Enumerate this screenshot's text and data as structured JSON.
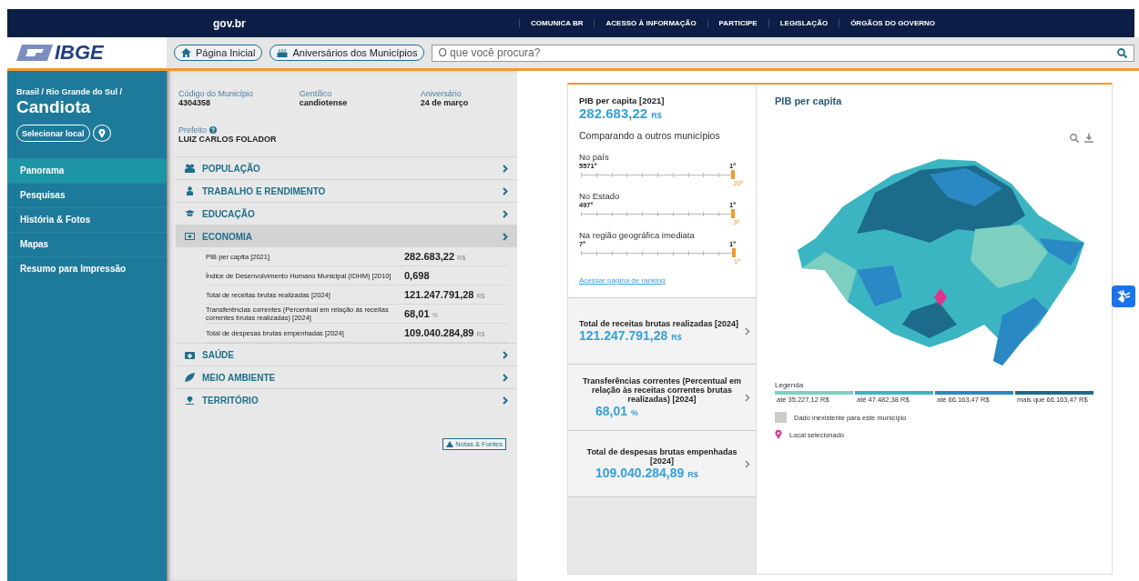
{
  "gov_bar": {
    "logo": "gov.br",
    "links": [
      "COMUNICA BR",
      "ACESSO À INFORMAÇÃO",
      "PARTICIPE",
      "LEGISLAÇÃO",
      "ÓRGÃOS DO GOVERNO"
    ]
  },
  "header": {
    "logo": "IBGE",
    "buttons": [
      {
        "label": "Página Inicial",
        "kind": "home"
      },
      {
        "label": "Aniversários dos Municípios",
        "kind": "cake"
      }
    ],
    "search": {
      "placeholder": "O que você procura?"
    }
  },
  "sidebar": {
    "breadcrumb": "Brasil / Rio Grande do Sul /",
    "place": "Candiota",
    "select_button": "Selecionar local",
    "items": [
      {
        "label": "Panorama",
        "selected": true
      },
      {
        "label": "Pesquisas",
        "selected": false
      },
      {
        "label": "História & Fotos",
        "selected": false
      },
      {
        "label": "Mapas",
        "selected": false
      },
      {
        "label": "Resumo para Impressão",
        "selected": false
      }
    ]
  },
  "info": {
    "fields": [
      {
        "label": "Código do Município",
        "value": "4304358"
      },
      {
        "label": "Gentílico",
        "value": "candiotense"
      },
      {
        "label": "Aniversário",
        "value": "24 de março"
      }
    ],
    "mayor": {
      "label": "Prefeito",
      "value": "LUIZ CARLOS FOLADOR"
    }
  },
  "sections": [
    {
      "label": "POPULAÇÃO",
      "kind": "people",
      "expanded": false
    },
    {
      "label": "TRABALHO E RENDIMENTO",
      "kind": "worker",
      "expanded": false
    },
    {
      "label": "EDUCAÇÃO",
      "kind": "cap",
      "expanded": false
    },
    {
      "label": "ECONOMIA",
      "kind": "money",
      "expanded": true,
      "rows": [
        {
          "label": "PIB per capita [2021]",
          "value": "282.683,22",
          "unit": "R$"
        },
        {
          "label": "Índice de Desenvolvimento Humano Municipal (IDHM) [2010]",
          "value": "0,698"
        },
        {
          "label": "Total de receitas brutas realizadas [2024]",
          "value": "121.247.791,28",
          "unit": "R$"
        },
        {
          "label": "Transferências correntes (Percentual em relação às receitas correntes brutas realizadas) [2024]",
          "value": "68,01",
          "unit": "%"
        },
        {
          "label": "Total de despesas brutas empenhadas [2024]",
          "value": "109.040.284,89",
          "unit": "R$"
        }
      ]
    },
    {
      "label": "SAÚDE",
      "kind": "health",
      "expanded": false
    },
    {
      "label": "MEIO AMBIENTE",
      "kind": "leaf",
      "expanded": false
    },
    {
      "label": "TERRITÓRIO",
      "kind": "pin",
      "expanded": false
    }
  ],
  "notes_button": "Notas & Fontes",
  "detail": {
    "title": "PIB per capita [2021]",
    "value": "282.683,22",
    "unit": "R$",
    "compare_title": "Comparando a outros municípios",
    "rankings": [
      {
        "label": "No país",
        "low": "5571º",
        "high": "1º",
        "rank": "20º",
        "level": 0.996
      },
      {
        "label": "No Estado",
        "low": "497º",
        "high": "1º",
        "rank": "3º",
        "level": 0.996
      },
      {
        "label": "Na região geográfica imediata",
        "low": "7º",
        "high": "1º",
        "rank": "1º",
        "level": 1
      }
    ],
    "ranking_link": "Acessar página de ranking",
    "cards": [
      {
        "title": "Total de receitas brutas realizadas [2024]",
        "value": "121.247.791,28",
        "unit": "R$",
        "centered": false
      },
      {
        "title": "Transferências correntes (Percentual em relação às receitas correntes brutas realizadas) [2024]",
        "value": "68,01",
        "unit": "%",
        "centered": true
      },
      {
        "title": "Total de despesas brutas empenhadas [2024]",
        "value": "109.040.284,89",
        "unit": "R$",
        "centered": true
      }
    ]
  },
  "map": {
    "title": "PIB per capita",
    "legend_title": "Legenda",
    "legend": [
      {
        "label": "até 35.227,12 R$",
        "color": "#7dcfc0"
      },
      {
        "label": "até 47.482,38 R$",
        "color": "#3cb5c2"
      },
      {
        "label": "até 66.163,47 R$",
        "color": "#2a88c4"
      },
      {
        "label": "mais que 66.163,47 R$",
        "color": "#1c6b8a"
      }
    ],
    "missing": "Dado inexistente para este município",
    "selected": "Local selecionado"
  }
}
